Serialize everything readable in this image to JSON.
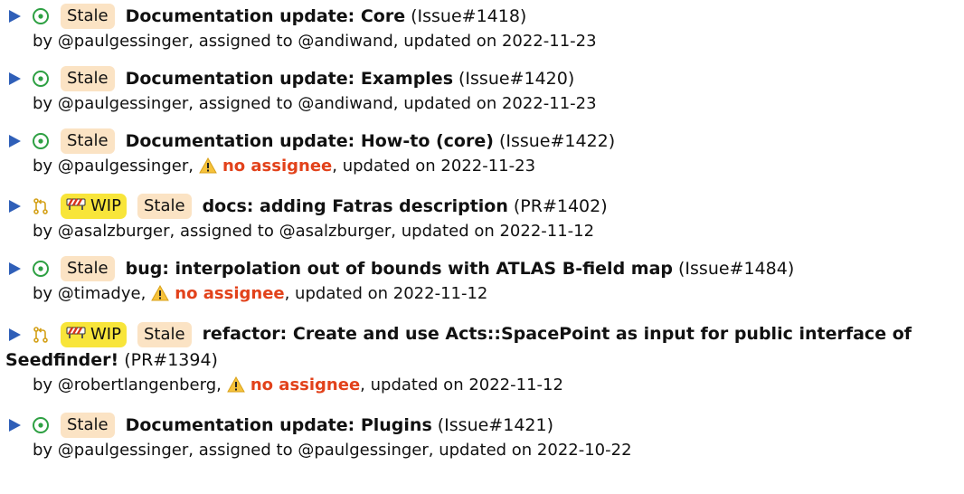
{
  "items": [
    {
      "kind": "issue",
      "badges": [
        "Stale"
      ],
      "title": "Documentation update: Core",
      "ref": "(Issue#1418)",
      "meta": {
        "by": "by @paulgessinger,",
        "assignment": "assigned to @andiwand,",
        "no_assignee": false,
        "updated": "updated on 2022-11-23"
      }
    },
    {
      "kind": "issue",
      "badges": [
        "Stale"
      ],
      "title": "Documentation update: Examples",
      "ref": "(Issue#1420)",
      "meta": {
        "by": "by @paulgessinger,",
        "assignment": "assigned to @andiwand,",
        "no_assignee": false,
        "updated": "updated on 2022-11-23"
      }
    },
    {
      "kind": "issue",
      "badges": [
        "Stale"
      ],
      "title": "Documentation update: How-to (core)",
      "ref": "(Issue#1422)",
      "meta": {
        "by": "by @paulgessinger,",
        "assignment": "no assignee",
        "no_assignee": true,
        "updated": ", updated on 2022-11-23"
      }
    },
    {
      "kind": "pr",
      "badges": [
        "WIP",
        "Stale"
      ],
      "title": "docs: adding Fatras description",
      "ref": "(PR#1402)",
      "meta": {
        "by": "by @asalzburger,",
        "assignment": "assigned to @asalzburger,",
        "no_assignee": false,
        "updated": "updated on 2022-11-12"
      }
    },
    {
      "kind": "issue",
      "badges": [
        "Stale"
      ],
      "title": "bug: interpolation out of bounds with ATLAS B-field map",
      "ref": "(Issue#1484)",
      "meta": {
        "by": "by @timadye,",
        "assignment": "no assignee",
        "no_assignee": true,
        "updated": ", updated on 2022-11-12"
      }
    },
    {
      "kind": "pr",
      "badges": [
        "WIP",
        "Stale"
      ],
      "title": "refactor: Create and use Acts::SpacePoint as input for public interface of Seedfinder!",
      "ref": "(PR#1394)",
      "wrap": true,
      "meta": {
        "by": "by @robertlangenberg,",
        "assignment": "no assignee",
        "no_assignee": true,
        "updated": ", updated on 2022-11-12"
      }
    },
    {
      "kind": "issue",
      "badges": [
        "Stale"
      ],
      "title": "Documentation update: Plugins",
      "ref": "(Issue#1421)",
      "meta": {
        "by": "by @paulgessinger,",
        "assignment": "assigned to @paulgessinger,",
        "no_assignee": false,
        "updated": "updated on 2022-10-22"
      }
    }
  ],
  "colors": {
    "expand_arrow": "#2f5fb8",
    "issue_open": "#2ea043",
    "pr_icon": "#d4a017",
    "stale_badge": "#fbe3c4",
    "wip_badge": "#f8e53a",
    "no_assignee": "#e2421b"
  },
  "icons": {
    "expand": "triangle-right-icon",
    "issue": "issue-open-icon",
    "pr": "pull-request-icon",
    "wip": "construction-barrier-icon",
    "warning": "warning-icon"
  }
}
